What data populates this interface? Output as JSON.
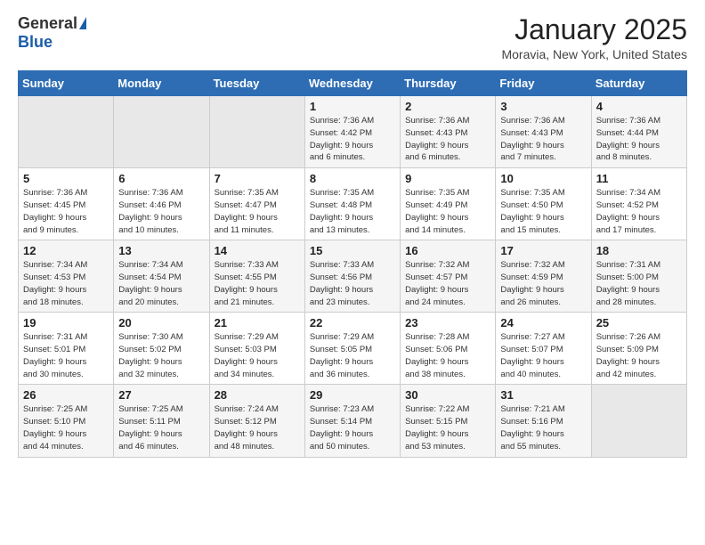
{
  "header": {
    "logo_general": "General",
    "logo_blue": "Blue",
    "month_title": "January 2025",
    "location": "Moravia, New York, United States"
  },
  "days_of_week": [
    "Sunday",
    "Monday",
    "Tuesday",
    "Wednesday",
    "Thursday",
    "Friday",
    "Saturday"
  ],
  "weeks": [
    [
      {
        "day": "",
        "data": ""
      },
      {
        "day": "",
        "data": ""
      },
      {
        "day": "",
        "data": ""
      },
      {
        "day": "1",
        "data": "Sunrise: 7:36 AM\nSunset: 4:42 PM\nDaylight: 9 hours\nand 6 minutes."
      },
      {
        "day": "2",
        "data": "Sunrise: 7:36 AM\nSunset: 4:43 PM\nDaylight: 9 hours\nand 6 minutes."
      },
      {
        "day": "3",
        "data": "Sunrise: 7:36 AM\nSunset: 4:43 PM\nDaylight: 9 hours\nand 7 minutes."
      },
      {
        "day": "4",
        "data": "Sunrise: 7:36 AM\nSunset: 4:44 PM\nDaylight: 9 hours\nand 8 minutes."
      }
    ],
    [
      {
        "day": "5",
        "data": "Sunrise: 7:36 AM\nSunset: 4:45 PM\nDaylight: 9 hours\nand 9 minutes."
      },
      {
        "day": "6",
        "data": "Sunrise: 7:36 AM\nSunset: 4:46 PM\nDaylight: 9 hours\nand 10 minutes."
      },
      {
        "day": "7",
        "data": "Sunrise: 7:35 AM\nSunset: 4:47 PM\nDaylight: 9 hours\nand 11 minutes."
      },
      {
        "day": "8",
        "data": "Sunrise: 7:35 AM\nSunset: 4:48 PM\nDaylight: 9 hours\nand 13 minutes."
      },
      {
        "day": "9",
        "data": "Sunrise: 7:35 AM\nSunset: 4:49 PM\nDaylight: 9 hours\nand 14 minutes."
      },
      {
        "day": "10",
        "data": "Sunrise: 7:35 AM\nSunset: 4:50 PM\nDaylight: 9 hours\nand 15 minutes."
      },
      {
        "day": "11",
        "data": "Sunrise: 7:34 AM\nSunset: 4:52 PM\nDaylight: 9 hours\nand 17 minutes."
      }
    ],
    [
      {
        "day": "12",
        "data": "Sunrise: 7:34 AM\nSunset: 4:53 PM\nDaylight: 9 hours\nand 18 minutes."
      },
      {
        "day": "13",
        "data": "Sunrise: 7:34 AM\nSunset: 4:54 PM\nDaylight: 9 hours\nand 20 minutes."
      },
      {
        "day": "14",
        "data": "Sunrise: 7:33 AM\nSunset: 4:55 PM\nDaylight: 9 hours\nand 21 minutes."
      },
      {
        "day": "15",
        "data": "Sunrise: 7:33 AM\nSunset: 4:56 PM\nDaylight: 9 hours\nand 23 minutes."
      },
      {
        "day": "16",
        "data": "Sunrise: 7:32 AM\nSunset: 4:57 PM\nDaylight: 9 hours\nand 24 minutes."
      },
      {
        "day": "17",
        "data": "Sunrise: 7:32 AM\nSunset: 4:59 PM\nDaylight: 9 hours\nand 26 minutes."
      },
      {
        "day": "18",
        "data": "Sunrise: 7:31 AM\nSunset: 5:00 PM\nDaylight: 9 hours\nand 28 minutes."
      }
    ],
    [
      {
        "day": "19",
        "data": "Sunrise: 7:31 AM\nSunset: 5:01 PM\nDaylight: 9 hours\nand 30 minutes."
      },
      {
        "day": "20",
        "data": "Sunrise: 7:30 AM\nSunset: 5:02 PM\nDaylight: 9 hours\nand 32 minutes."
      },
      {
        "day": "21",
        "data": "Sunrise: 7:29 AM\nSunset: 5:03 PM\nDaylight: 9 hours\nand 34 minutes."
      },
      {
        "day": "22",
        "data": "Sunrise: 7:29 AM\nSunset: 5:05 PM\nDaylight: 9 hours\nand 36 minutes."
      },
      {
        "day": "23",
        "data": "Sunrise: 7:28 AM\nSunset: 5:06 PM\nDaylight: 9 hours\nand 38 minutes."
      },
      {
        "day": "24",
        "data": "Sunrise: 7:27 AM\nSunset: 5:07 PM\nDaylight: 9 hours\nand 40 minutes."
      },
      {
        "day": "25",
        "data": "Sunrise: 7:26 AM\nSunset: 5:09 PM\nDaylight: 9 hours\nand 42 minutes."
      }
    ],
    [
      {
        "day": "26",
        "data": "Sunrise: 7:25 AM\nSunset: 5:10 PM\nDaylight: 9 hours\nand 44 minutes."
      },
      {
        "day": "27",
        "data": "Sunrise: 7:25 AM\nSunset: 5:11 PM\nDaylight: 9 hours\nand 46 minutes."
      },
      {
        "day": "28",
        "data": "Sunrise: 7:24 AM\nSunset: 5:12 PM\nDaylight: 9 hours\nand 48 minutes."
      },
      {
        "day": "29",
        "data": "Sunrise: 7:23 AM\nSunset: 5:14 PM\nDaylight: 9 hours\nand 50 minutes."
      },
      {
        "day": "30",
        "data": "Sunrise: 7:22 AM\nSunset: 5:15 PM\nDaylight: 9 hours\nand 53 minutes."
      },
      {
        "day": "31",
        "data": "Sunrise: 7:21 AM\nSunset: 5:16 PM\nDaylight: 9 hours\nand 55 minutes."
      },
      {
        "day": "",
        "data": ""
      }
    ]
  ]
}
